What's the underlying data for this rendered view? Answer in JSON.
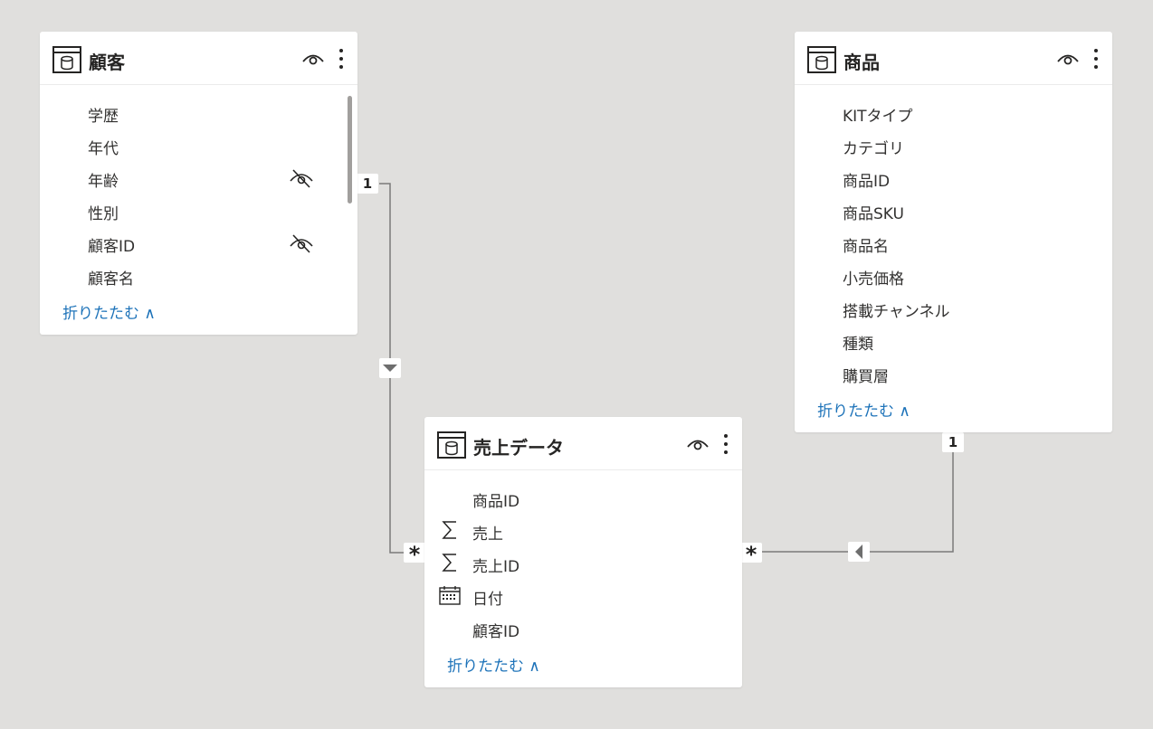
{
  "tables": {
    "customer": {
      "title": "顧客",
      "fields": [
        {
          "label": "学歴",
          "hidden": false
        },
        {
          "label": "年代",
          "hidden": false
        },
        {
          "label": "年齢",
          "hidden": true
        },
        {
          "label": "性別",
          "hidden": false
        },
        {
          "label": "顧客ID",
          "hidden": true
        },
        {
          "label": "顧客名",
          "hidden": false
        }
      ],
      "collapse_label": "折りたたむ ∧"
    },
    "product": {
      "title": "商品",
      "fields": [
        {
          "label": "KITタイプ"
        },
        {
          "label": "カテゴリ"
        },
        {
          "label": "商品ID"
        },
        {
          "label": "商品SKU"
        },
        {
          "label": "商品名"
        },
        {
          "label": "小売価格"
        },
        {
          "label": "搭載チャンネル"
        },
        {
          "label": "種類"
        },
        {
          "label": "購買層"
        }
      ],
      "collapse_label": "折りたたむ ∧"
    },
    "sales": {
      "title": "売上データ",
      "fields": [
        {
          "label": "商品ID",
          "icon": "none"
        },
        {
          "label": "売上",
          "icon": "sigma-icon"
        },
        {
          "label": "売上ID",
          "icon": "sigma-icon"
        },
        {
          "label": "日付",
          "icon": "calendar-icon"
        },
        {
          "label": "顧客ID",
          "icon": "none"
        }
      ],
      "collapse_label": "折りたたむ ∧"
    }
  },
  "relationships": [
    {
      "from": "顧客",
      "to": "売上データ",
      "one_label": "1",
      "many_label": "*",
      "filter_direction": "down"
    },
    {
      "from": "商品",
      "to": "売上データ",
      "one_label": "1",
      "many_label": "*",
      "filter_direction": "left"
    }
  ],
  "colors": {
    "canvas": "#e0dfdd",
    "card": "#ffffff",
    "link": "#1e73b9",
    "line": "#7a7a7a",
    "icon": "#252423"
  }
}
